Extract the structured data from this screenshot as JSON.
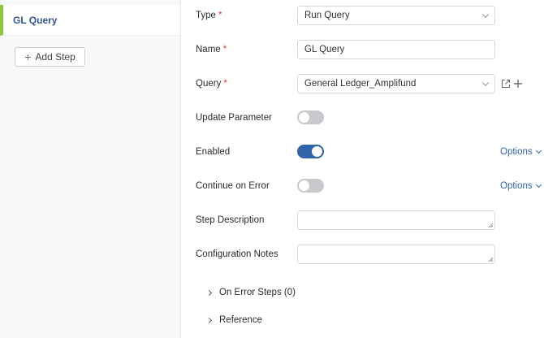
{
  "sidebar": {
    "active_step": "GL Query",
    "add_step_label": "Add Step"
  },
  "form": {
    "type": {
      "label": "Type",
      "required_mark": "*",
      "value": "Run Query"
    },
    "name": {
      "label": "Name",
      "required_mark": "*",
      "value": "GL Query"
    },
    "query": {
      "label": "Query",
      "required_mark": "*",
      "value": "General Ledger_Amplifund"
    },
    "update_parameter": {
      "label": "Update Parameter",
      "enabled": false
    },
    "enabled": {
      "label": "Enabled",
      "enabled": true,
      "options_label": "Options"
    },
    "continue_on_error": {
      "label": "Continue on Error",
      "enabled": false,
      "options_label": "Options"
    },
    "step_description": {
      "label": "Step Description",
      "value": ""
    },
    "configuration_notes": {
      "label": "Configuration Notes",
      "value": ""
    },
    "on_error_steps": {
      "label": "On Error Steps (0)"
    },
    "reference": {
      "label": "Reference"
    }
  },
  "colors": {
    "accent_blue": "#2f64a8",
    "step_indicator_green": "#8cc63f",
    "required_red": "#e0403a",
    "toggle_off": "#c7c9cd"
  },
  "icons": [
    "plus-icon",
    "chevron-down-icon",
    "open-external-icon",
    "chevron-right-icon"
  ]
}
